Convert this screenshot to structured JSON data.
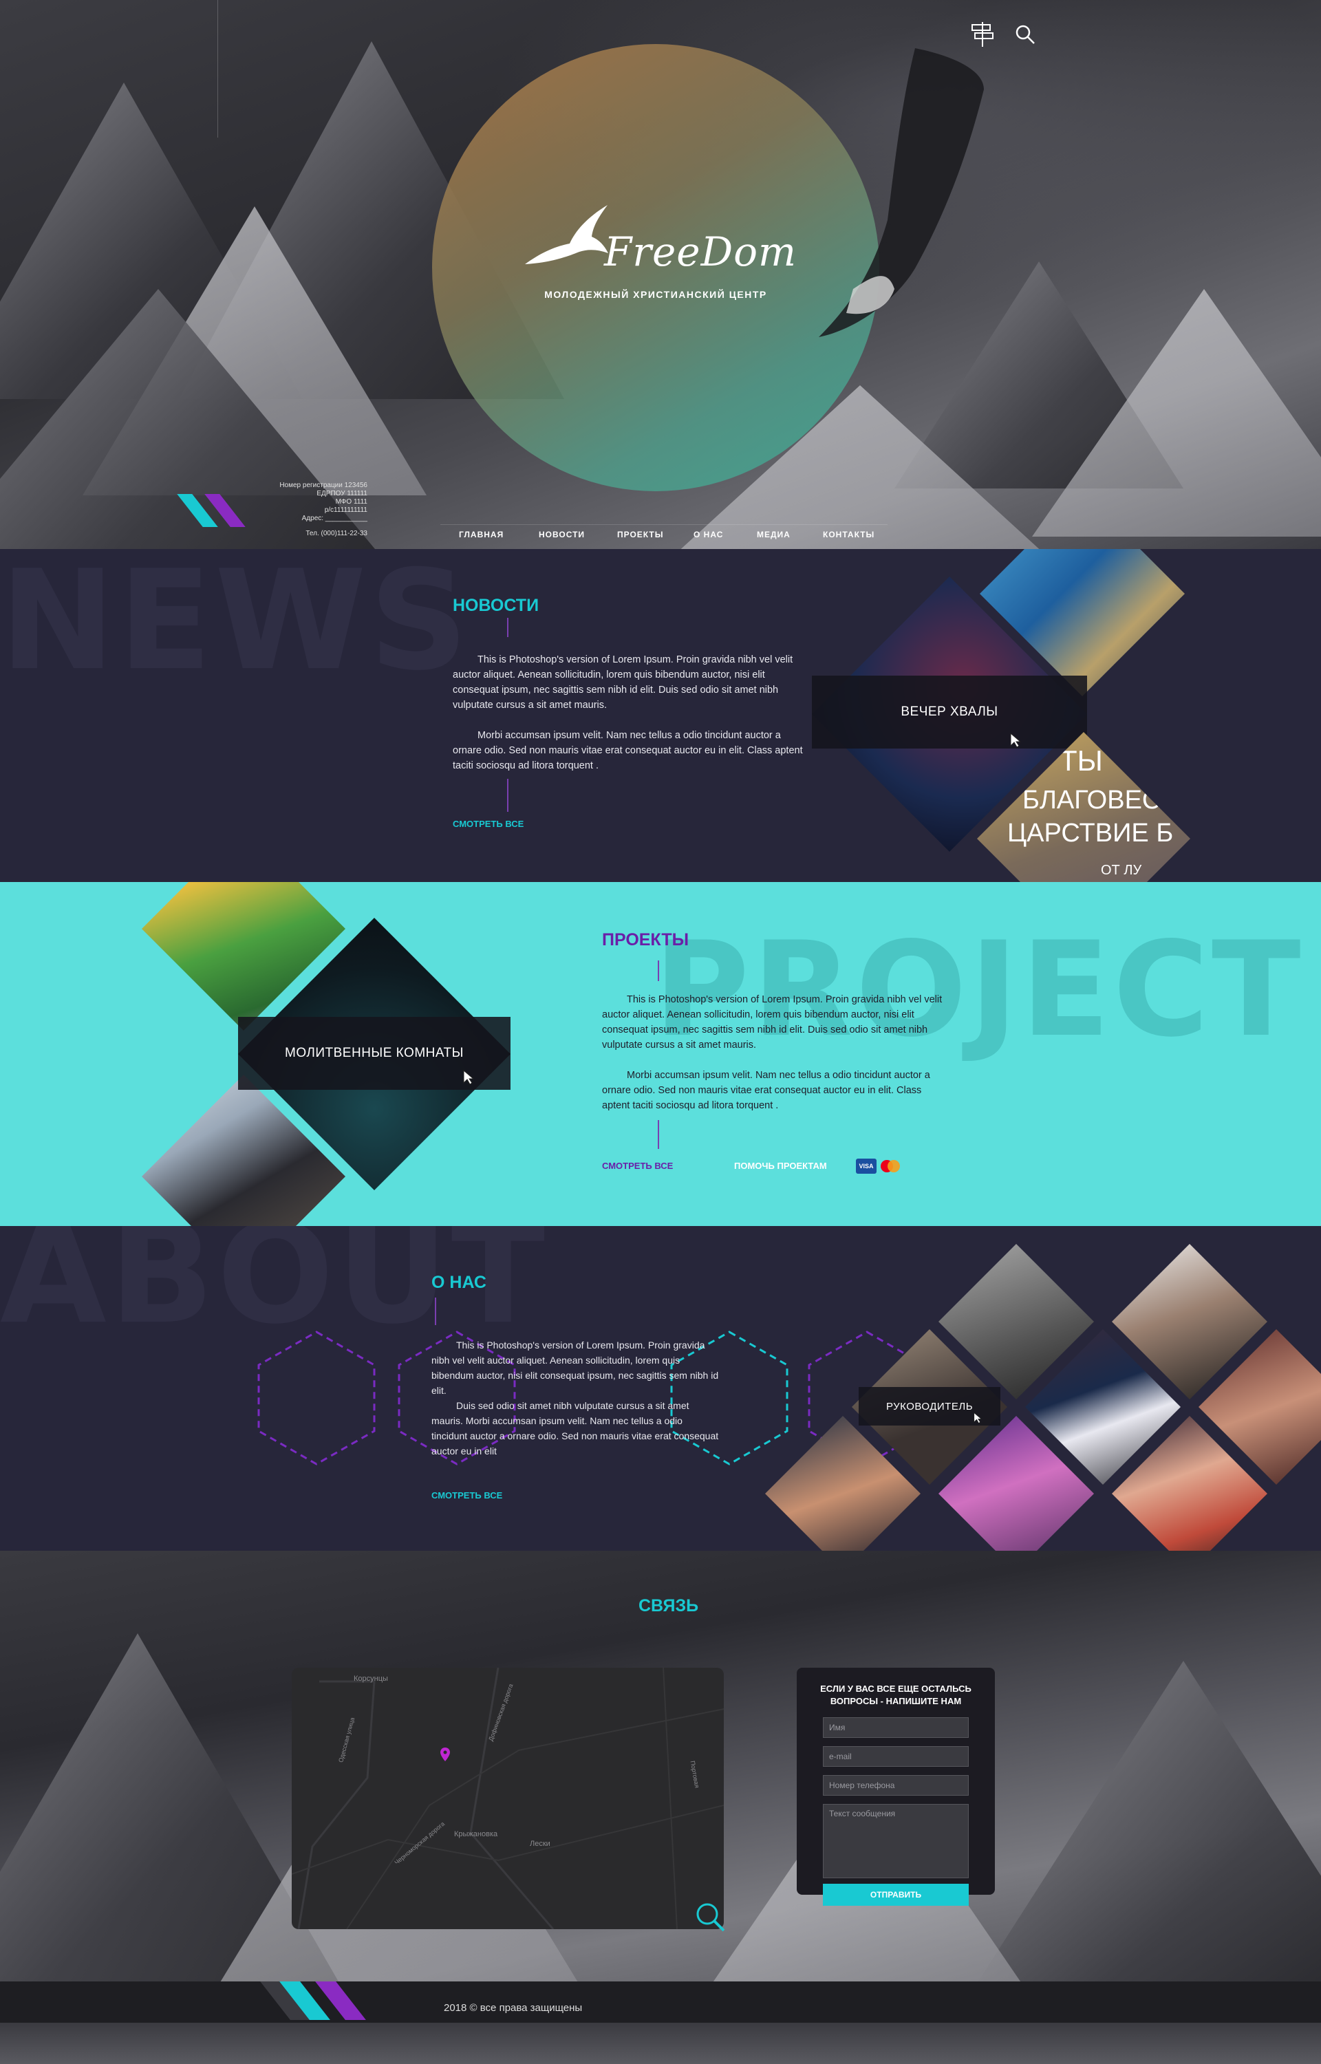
{
  "hero": {
    "logo_text": "FreeDom",
    "subtitle": "МОЛОДЕЖНЫЙ ХРИСТИАНСКИЙ ЦЕНТР",
    "top_icons": [
      "signpost-icon",
      "search-icon"
    ],
    "reg_info": [
      "Номер регистрации 123456",
      "ЕДРПОУ 111111",
      "МФО 1111",
      "р/с1111111111",
      "Адрес: ___________",
      "Тел. (000)111-22-33"
    ],
    "nav": [
      "ГЛАВНАЯ",
      "НОВОСТИ",
      "ПРОЕКТЫ",
      "О НАС",
      "МЕДИА",
      "КОНТАКТЫ"
    ]
  },
  "news": {
    "bg_word": "NEWS",
    "title": "НОВОСТИ",
    "paragraphs": [
      "This is Photoshop's version  of Lorem Ipsum. Proin gravida nibh vel velit auctor aliquet. Aenean sollicitudin, lorem quis bibendum auctor, nisi elit consequat ipsum, nec sagittis sem nibh id elit. Duis sed odio sit amet nibh vulputate cursus a sit amet mauris.",
      "Morbi accumsan ipsum velit. Nam nec tellus a odio tincidunt auctor a ornare odio. Sed non  mauris vitae erat consequat auctor eu in elit. Class aptent taciti sociosqu ad litora torquent ."
    ],
    "see_all": "СМОТРЕТЬ ВСЕ",
    "banner": "ВЕЧЕР ХВАЛЫ",
    "poster_text": [
      "ТЫ",
      "БЛАГОВЕС",
      "ЦАРСТВИЕ Б",
      "ОТ ЛУ"
    ]
  },
  "project": {
    "bg_word": "PROJECT",
    "title": "ПРОЕКТЫ",
    "paragraphs": [
      "This is Photoshop's version  of Lorem Ipsum. Proin gravida nibh vel velit auctor aliquet. Aenean sollicitudin, lorem quis bibendum auctor, nisi elit consequat ipsum, nec sagittis sem nibh id elit. Duis sed odio sit amet nibh vulputate cursus a sit amet mauris.",
      "Morbi accumsan ipsum velit. Nam nec tellus a odio tincidunt auctor a ornare odio. Sed non  mauris vitae erat consequat auctor eu in elit. Class aptent taciti sociosqu ad litora torquent ."
    ],
    "see_all": "СМОТРЕТЬ ВСЕ",
    "help": "ПОМОЧЬ ПРОЕКТАМ",
    "visa": "VISA",
    "banner": "МОЛИТВЕННЫЕ КОМНАТЫ"
  },
  "about": {
    "bg_word": "ABOUT",
    "title": "О НАС",
    "paragraphs": [
      "This is Photoshop's version  of Lorem Ipsum. Proin gravida nibh vel velit auctor aliquet. Aenean sollicitudin, lorem quis bibendum auctor, nisi elit consequat ipsum, nec sagittis sem nibh id elit.",
      "Duis sed odio sit amet nibh vulputate cursus a sit amet mauris. Morbi accumsan ipsum velit. Nam nec tellus a odio tincidunt auctor a ornare odio. Sed non  mauris vitae erat consequat auctor eu in elit"
    ],
    "see_all": "СМОТРЕТЬ ВСЕ",
    "banner": "РУКОВОДИТЕЛЬ"
  },
  "contact": {
    "title": "СВЯЗЬ",
    "map_labels": [
      "Корсунцы",
      "Крыжановка",
      "Лески",
      "Дофиновская дорога",
      "Одесская улица",
      "Черноморская дорога",
      "Портовая"
    ],
    "form_title": "ЕСЛИ У ВАС ВСЕ ЕЩЕ ОСТАЛЬСЬ ВОПРОСЫ - НАПИШИТЕ НАМ",
    "name_placeholder": "Имя",
    "email_placeholder": "e-mail",
    "phone_placeholder": "Номер телефона",
    "message_placeholder": "Текст сообщения",
    "submit": "ОТПРАВИТЬ"
  },
  "footer": {
    "copyright": "2018 © все права защищены"
  },
  "colors": {
    "accent_cyan": "#19c9d2",
    "accent_purple": "#8a2bc2",
    "dark_bg": "#27263a",
    "project_bg": "#5cdfdc"
  }
}
